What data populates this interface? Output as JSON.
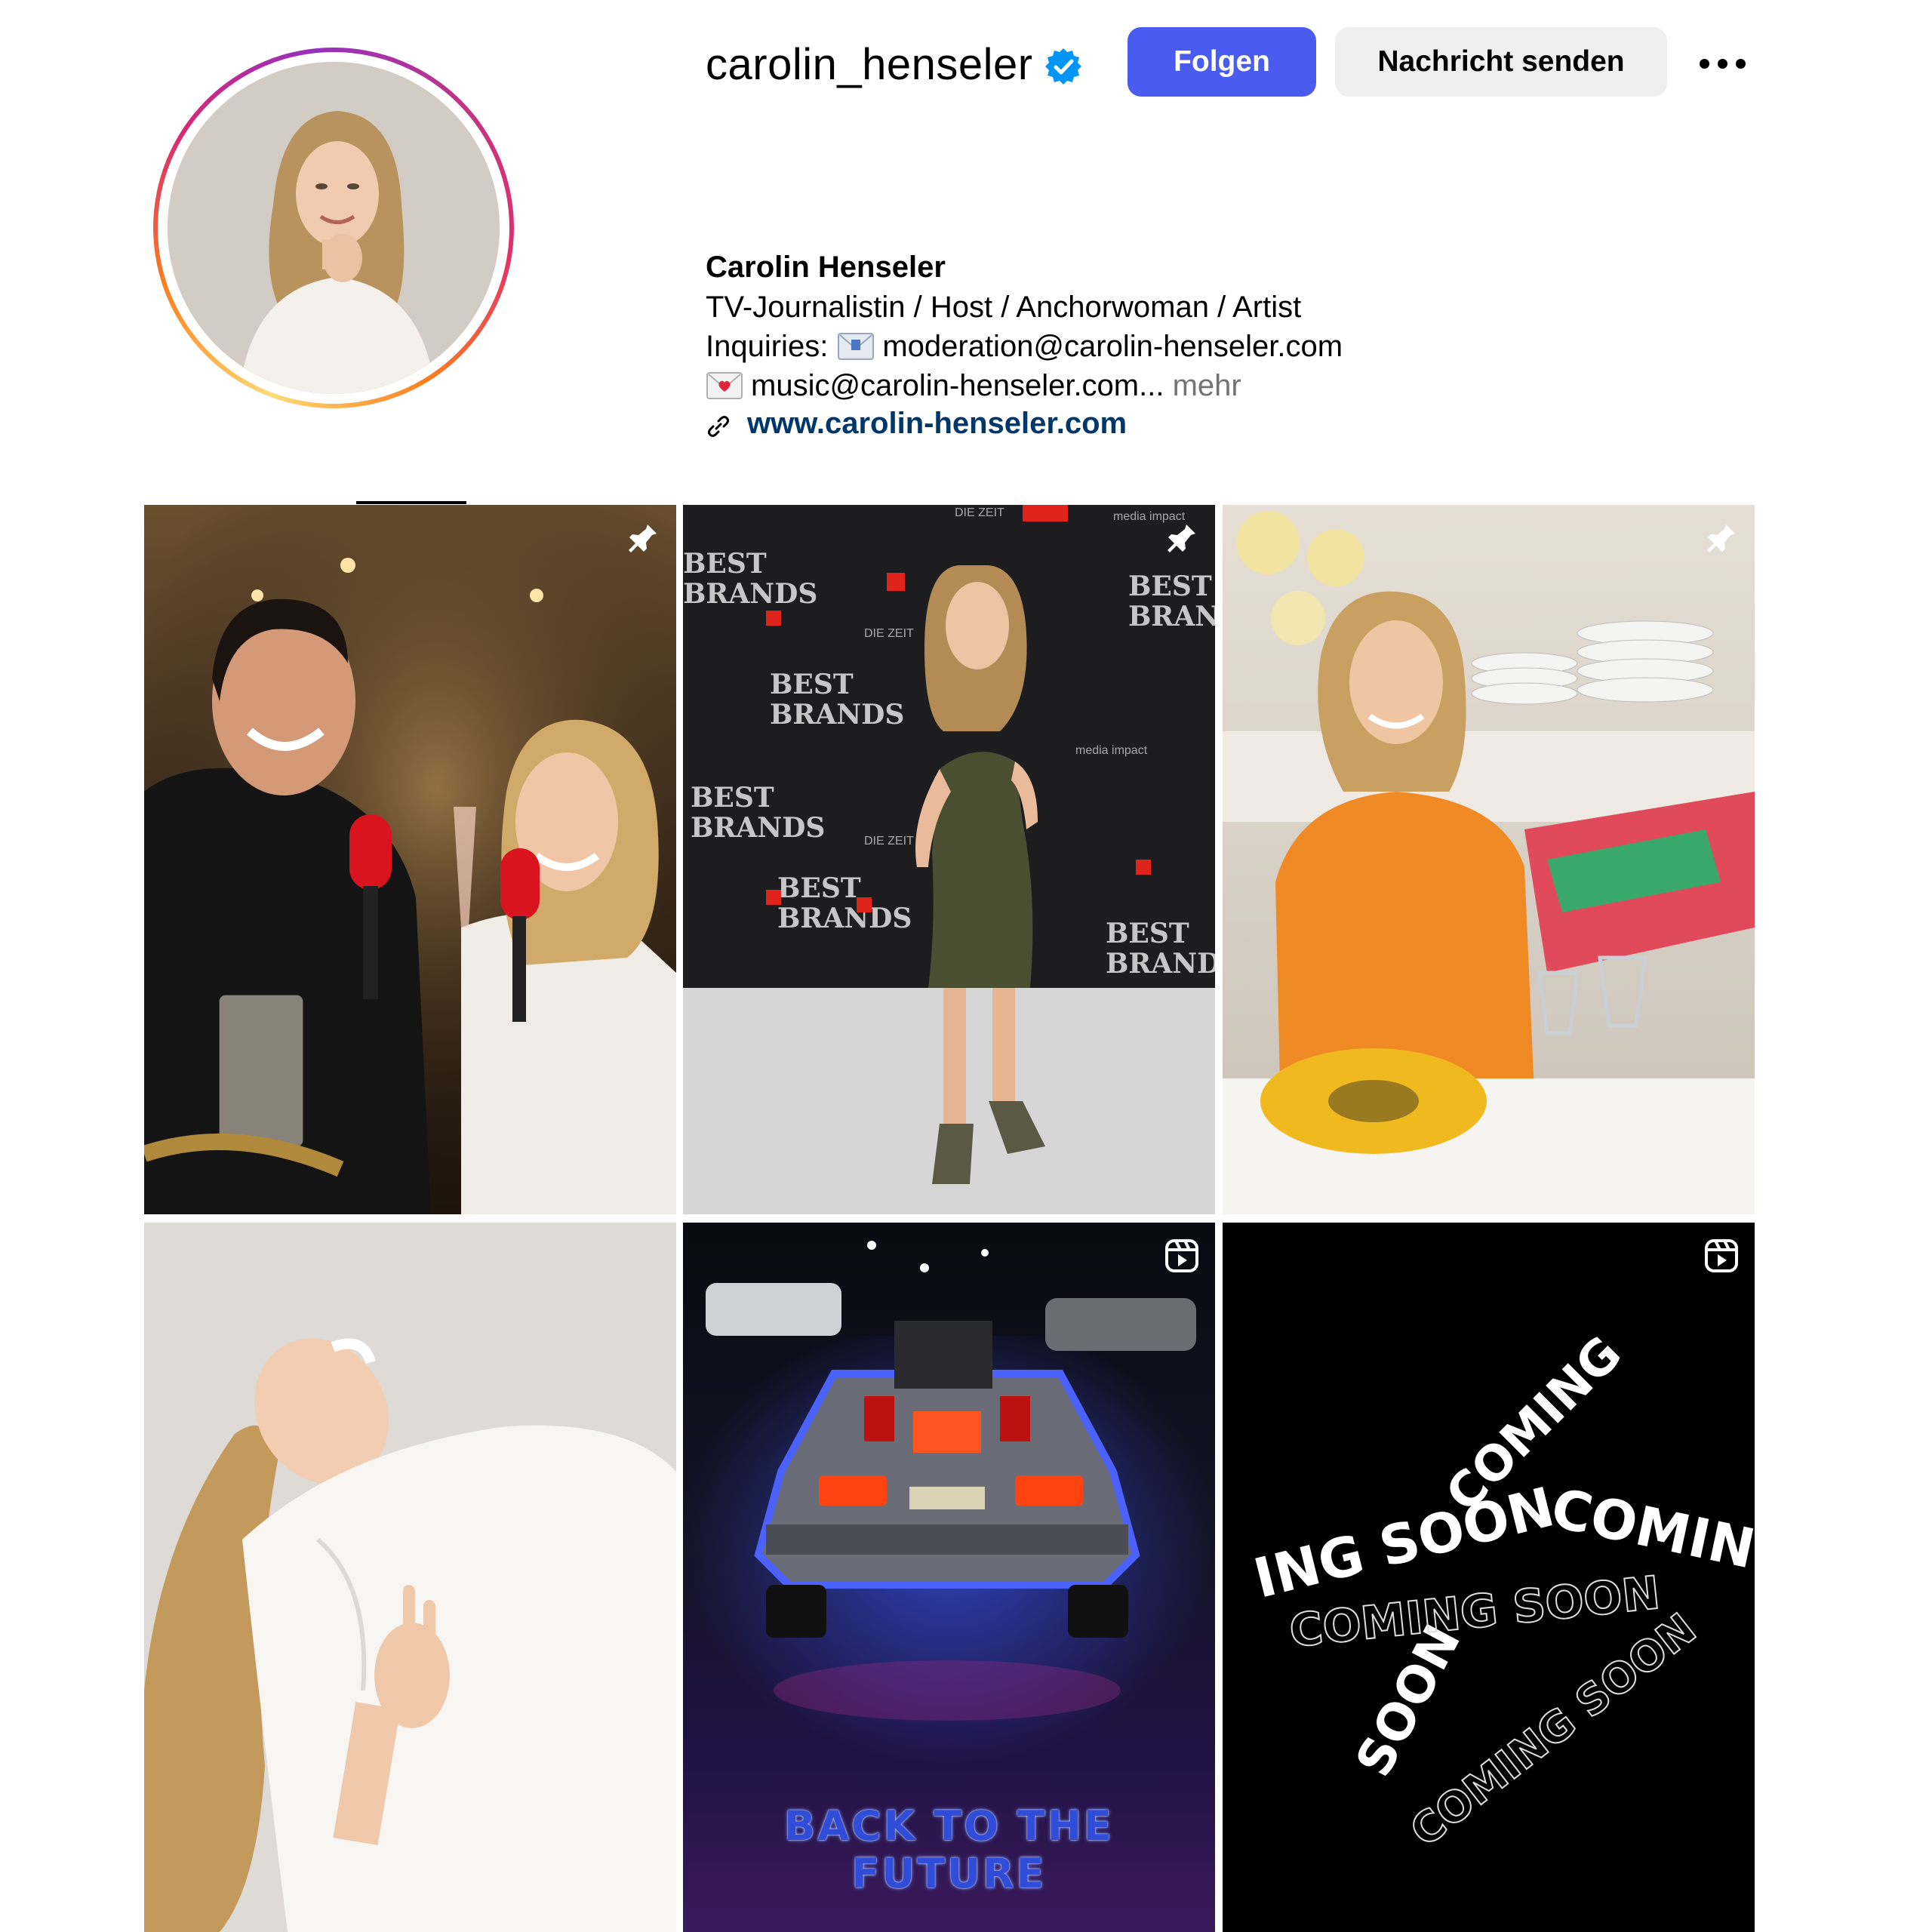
{
  "profile": {
    "username": "carolin_henseler",
    "verified_icon": "verified-badge-icon",
    "follow_label": "Folgen",
    "message_label": "Nachricht senden",
    "more_icon": "more-options-icon"
  },
  "bio": {
    "name": "Carolin Henseler",
    "line1": "TV-Journalistin / Host / Anchorwoman / Artist",
    "line2_prefix": "Inquiries:",
    "line2_email": "moderation@carolin-henseler.com",
    "line3_email": "music@carolin-henseler.com...",
    "more_label": "mehr",
    "link": "www.carolin-henseler.com"
  },
  "colors": {
    "follow_button": "#4a5cf0",
    "link": "#00376b",
    "secondary_text": "#737373"
  },
  "posts": [
    {
      "kind": "photo",
      "pinned": true,
      "icon": "pin-icon"
    },
    {
      "kind": "photo",
      "pinned": true,
      "icon": "pin-icon"
    },
    {
      "kind": "photo",
      "pinned": true,
      "icon": "pin-icon"
    },
    {
      "kind": "photo",
      "pinned": false
    },
    {
      "kind": "reel",
      "icon": "reel-icon",
      "caption": "BACK TO THE FUTURE"
    },
    {
      "kind": "reel",
      "icon": "reel-icon",
      "caption": "COMING SOON"
    }
  ]
}
